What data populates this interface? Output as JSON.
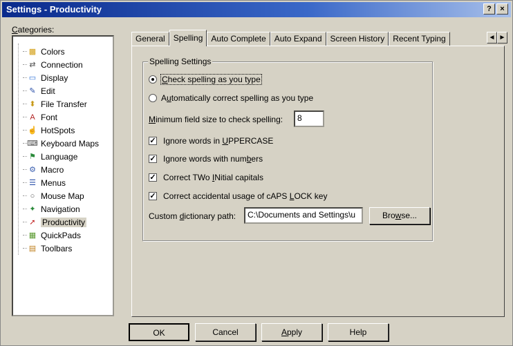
{
  "window": {
    "title": "Settings - Productivity",
    "help_button": "?",
    "close_button": "×"
  },
  "categories": {
    "label_prefix": "",
    "label_underline": "C",
    "label_rest": "ategories:",
    "items": [
      {
        "label": "Colors",
        "icon": "colors-icon",
        "glyph": "▩",
        "color": "#d4a017"
      },
      {
        "label": "Connection",
        "icon": "connection-icon",
        "glyph": "⇄",
        "color": "#555555"
      },
      {
        "label": "Display",
        "icon": "display-icon",
        "glyph": "▭",
        "color": "#2a6fd6"
      },
      {
        "label": "Edit",
        "icon": "edit-icon",
        "glyph": "✎",
        "color": "#2a4fa8"
      },
      {
        "label": "File Transfer",
        "icon": "file-transfer-icon",
        "glyph": "⬍",
        "color": "#c89a1a"
      },
      {
        "label": "Font",
        "icon": "font-icon",
        "glyph": "A",
        "color": "#b02020"
      },
      {
        "label": "HotSpots",
        "icon": "hotspots-icon",
        "glyph": "☝",
        "color": "#333333"
      },
      {
        "label": "Keyboard Maps",
        "icon": "keyboard-icon",
        "glyph": "⌨",
        "color": "#555555"
      },
      {
        "label": "Language",
        "icon": "language-icon",
        "glyph": "⚑",
        "color": "#2a8a3a"
      },
      {
        "label": "Macro",
        "icon": "macro-icon",
        "glyph": "⚙",
        "color": "#3a5fb0"
      },
      {
        "label": "Menus",
        "icon": "menus-icon",
        "glyph": "☰",
        "color": "#2a4fa8"
      },
      {
        "label": "Mouse Map",
        "icon": "mouse-icon",
        "glyph": "○",
        "color": "#555555"
      },
      {
        "label": "Navigation",
        "icon": "navigation-icon",
        "glyph": "✦",
        "color": "#2a8a3a"
      },
      {
        "label": "Productivity",
        "icon": "productivity-icon",
        "glyph": "➚",
        "color": "#c02020"
      },
      {
        "label": "QuickPads",
        "icon": "quickpads-icon",
        "glyph": "▦",
        "color": "#5a9a30"
      },
      {
        "label": "Toolbars",
        "icon": "toolbars-icon",
        "glyph": "▤",
        "color": "#c08020"
      }
    ],
    "selected_index": 13
  },
  "tabs": [
    "General",
    "Spelling",
    "Auto Complete",
    "Auto Expand",
    "Screen History",
    "Recent Typing"
  ],
  "active_tab": 1,
  "tab_scroll": {
    "left": "◄",
    "right": "►"
  },
  "spelling": {
    "group_title": "Spelling Settings",
    "radio_check_as_type": {
      "pre": "",
      "ul": "C",
      "post": "heck spelling as you type",
      "checked": true
    },
    "radio_auto_correct": {
      "pre": "A",
      "ul": "u",
      "post": "tomatically correct spelling as you type",
      "checked": false
    },
    "min_field_label": {
      "pre": "",
      "ul": "M",
      "post": "inimum field size to check spelling:"
    },
    "min_field_value": "8",
    "options": [
      {
        "pre": "Ignore words in ",
        "ul": "U",
        "post": "PPERCASE",
        "checked": true
      },
      {
        "pre": "Ignore words with num",
        "ul": "b",
        "post": "ers",
        "checked": true
      },
      {
        "pre": "Correct TWo ",
        "ul": "I",
        "post": "Nitial capitals",
        "checked": true
      },
      {
        "pre": "Correct accidental usage of cAPS ",
        "ul": "L",
        "post": "OCK key",
        "checked": true
      }
    ],
    "dict_label": {
      "pre": "Custom ",
      "ul": "d",
      "post": "ictionary path:"
    },
    "dict_value": "C:\\Documents and Settings\\u",
    "browse": {
      "pre": "Bro",
      "ul": "w",
      "post": "se..."
    }
  },
  "buttons": {
    "ok": "OK",
    "cancel": "Cancel",
    "apply": {
      "pre": "",
      "ul": "A",
      "post": "pply"
    },
    "help": "Help"
  }
}
